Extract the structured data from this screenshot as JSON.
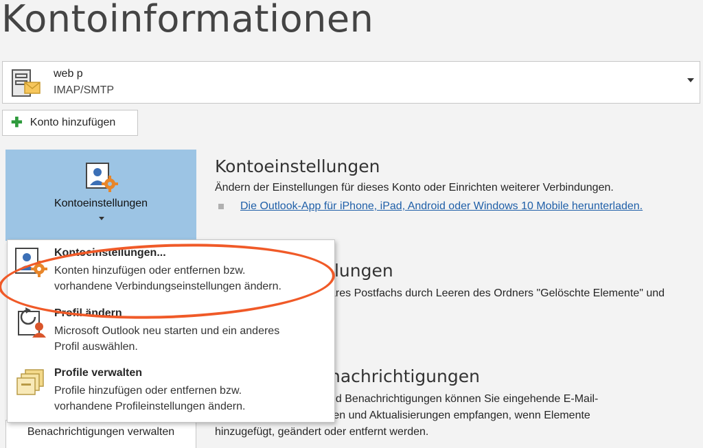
{
  "page": {
    "title": "Kontoinformationen"
  },
  "account_selector": {
    "name": "web p",
    "type": "IMAP/SMTP"
  },
  "add_account": {
    "label": "Konto hinzufügen"
  },
  "settings_tile": {
    "label": "Kontoeinstellungen"
  },
  "section_account_settings": {
    "title": "Kontoeinstellungen",
    "description": "Ändern der Einstellungen für dieses Konto oder Einrichten weiterer Verbindungen.",
    "link": "Die Outlook-App für iPhone, iPad, Android oder Windows 10 Mobile herunterladen."
  },
  "section_cleanup": {
    "title": "llungen",
    "text": "ares Postfachs durch Leeren des Ordners \"Gelöschte Elemente\" und"
  },
  "section_notifications": {
    "title": "nachrichtigungen",
    "line1": "nd Benachrichtigungen können Sie eingehende E-Mail-",
    "line2": "ren und Aktualisierungen empfangen, wenn Elemente",
    "line3": "hinzugefügt, geändert oder entfernt werden."
  },
  "notifications_button": {
    "label": "Benachrichtigungen verwalten"
  },
  "dropdown_menu": {
    "items": [
      {
        "title": "Kontoeinstellungen...",
        "line1": "Konten hinzufügen oder entfernen bzw.",
        "line2": "vorhandene Verbindungseinstellungen ändern.",
        "icon": "account-settings-icon"
      },
      {
        "title": "Profil ändern",
        "line1": "Microsoft Outlook neu starten und ein anderes",
        "line2": "Profil auswählen.",
        "icon": "change-profile-icon"
      },
      {
        "title": "Profile verwalten",
        "line1": "Profile hinzufügen oder entfernen bzw.",
        "line2": "vorhandene Profileinstellungen ändern.",
        "icon": "manage-profiles-icon"
      }
    ]
  },
  "colors": {
    "background": "#f3f3f3",
    "tile": "#9cc4e4",
    "link": "#1f5fa8",
    "annotation": "#f05a28",
    "plus": "#2e9a3c"
  }
}
